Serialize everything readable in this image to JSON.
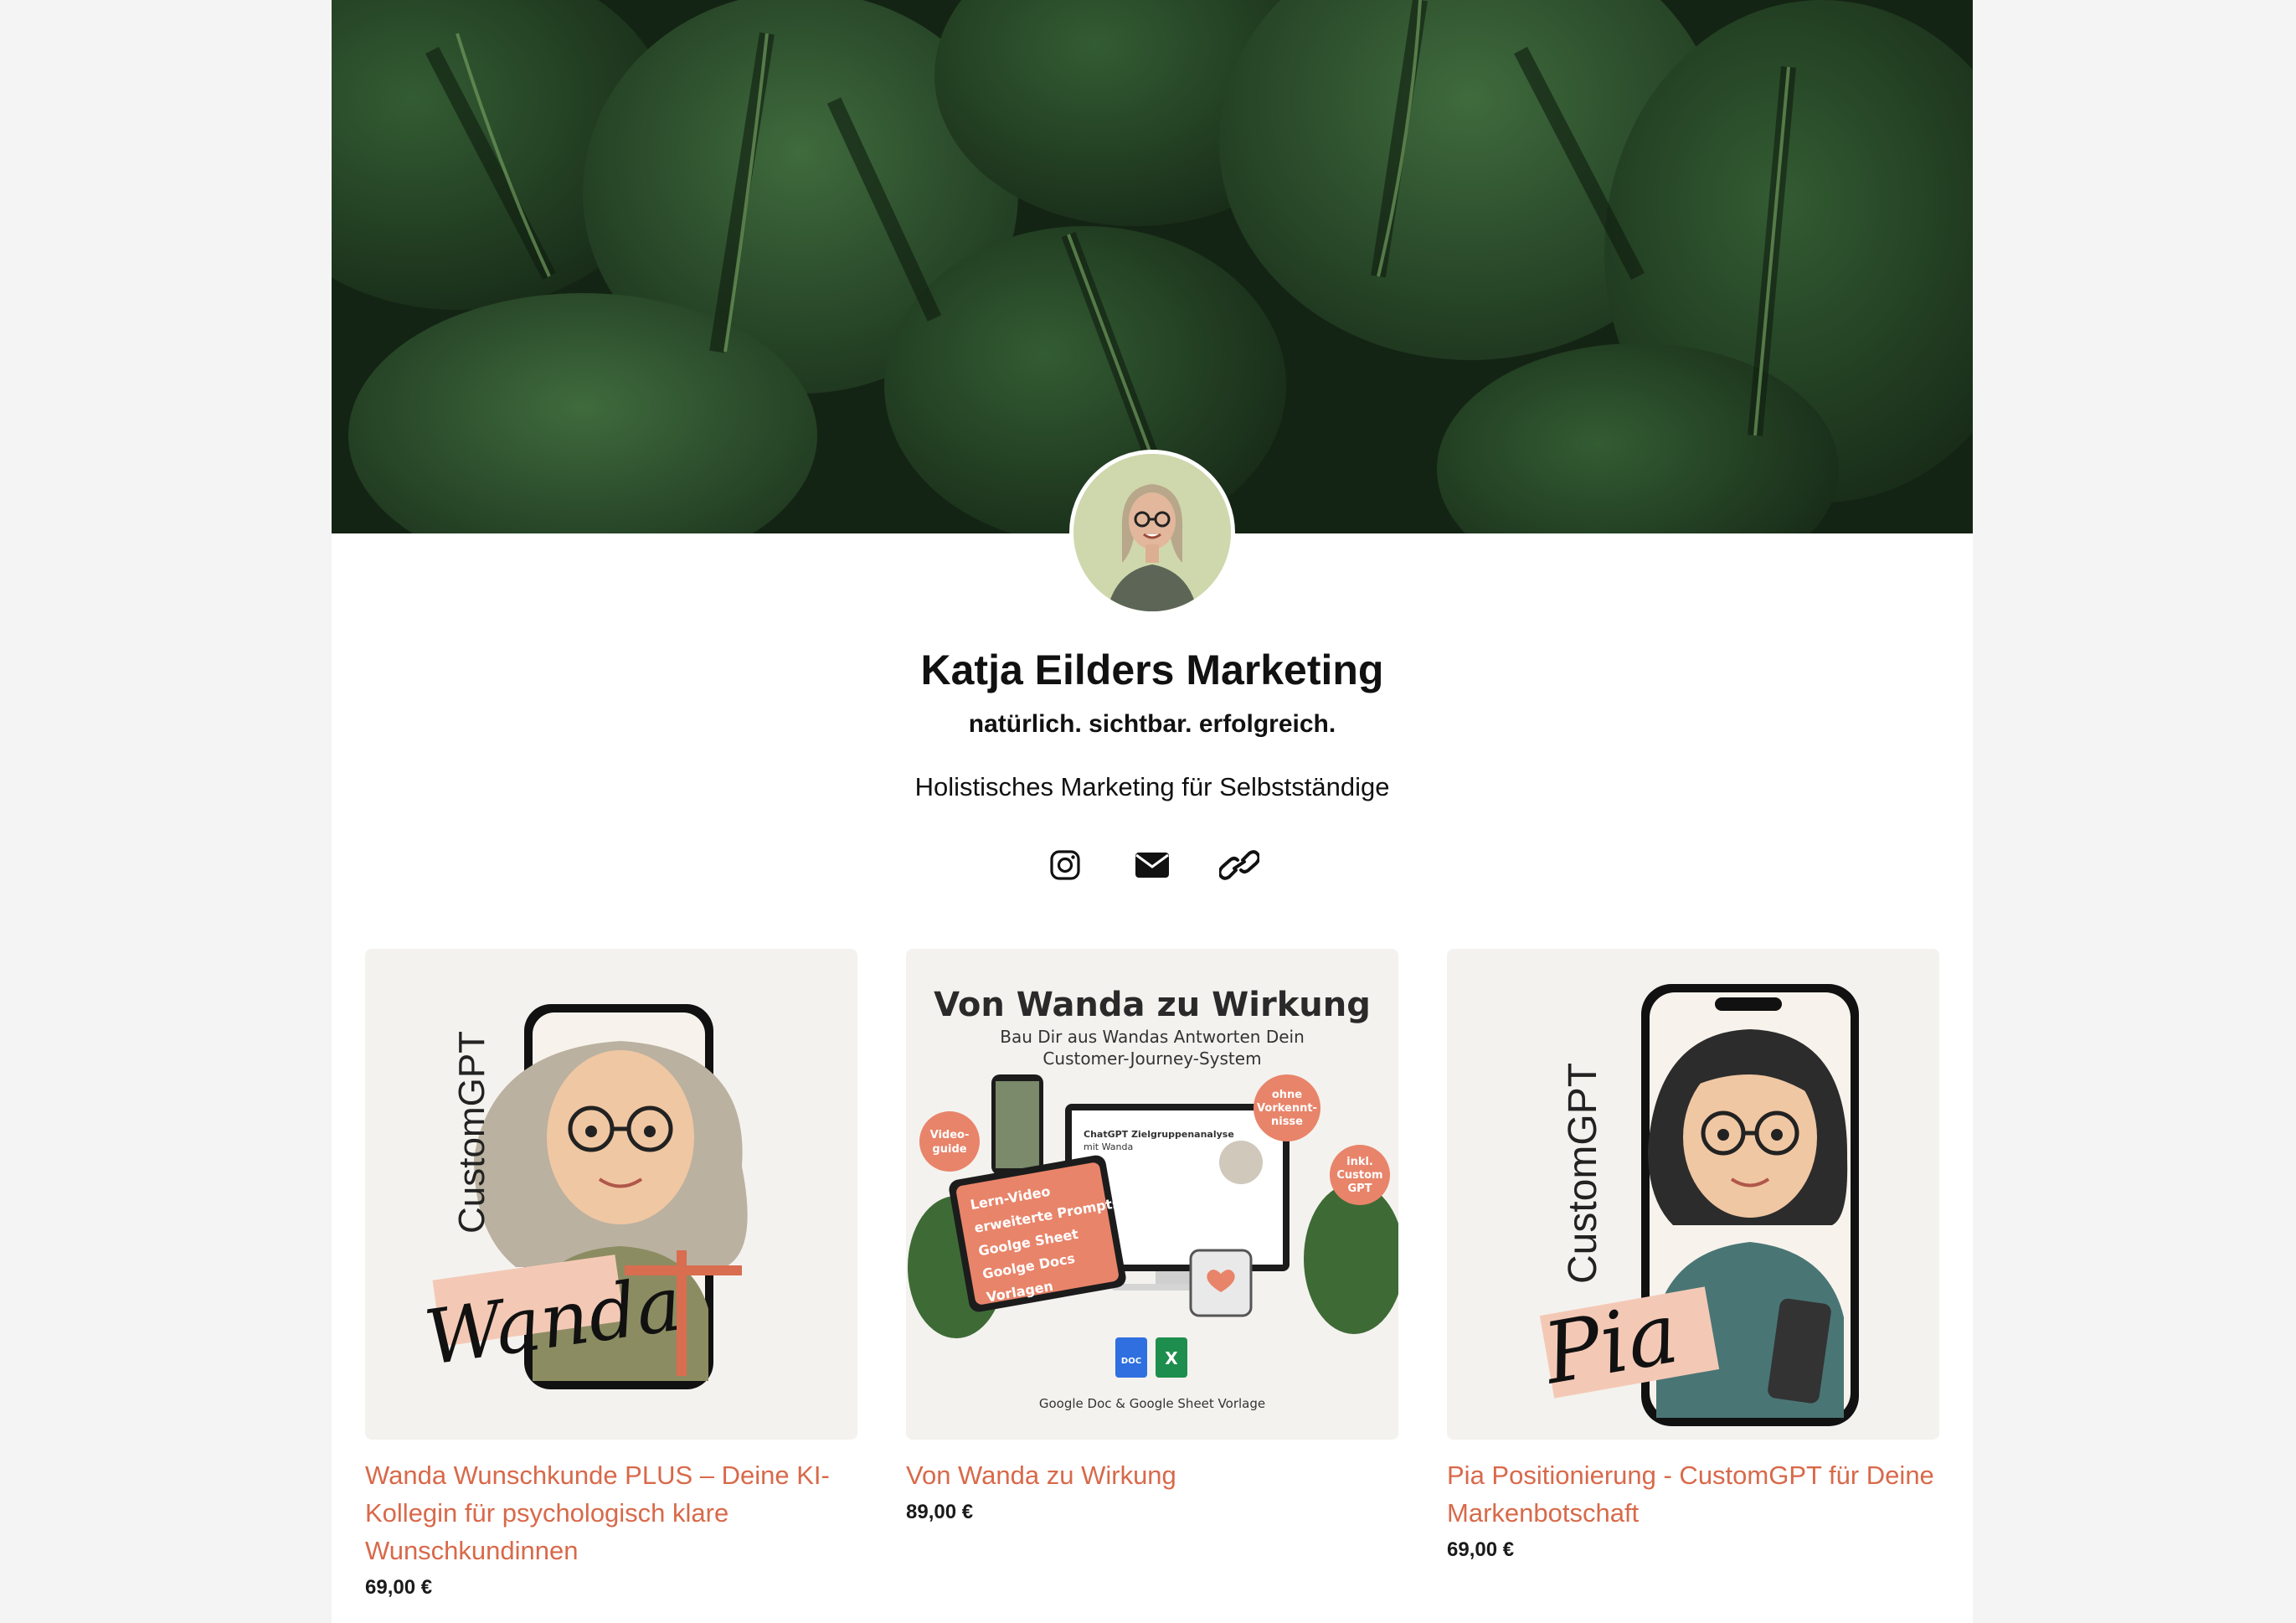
{
  "profile": {
    "name": "Katja Eilders Marketing",
    "tagline": "natürlich. sichtbar. erfolgreich.",
    "description": "Holistisches Marketing für Selbstständige"
  },
  "socials": [
    {
      "icon": "instagram-icon"
    },
    {
      "icon": "mail-icon"
    },
    {
      "icon": "link-icon"
    }
  ],
  "products": [
    {
      "title": "Wanda Wunschkunde PLUS – Deine KI-Kollegin für psychologisch klare Wunschkundinnen",
      "price": "69,00 €",
      "image": {
        "label": "CustomGPT",
        "script": "Wanda"
      }
    },
    {
      "title": "Von Wanda zu Wirkung",
      "price": "89,00 €",
      "image": {
        "heading": "Von Wanda zu Wirkung",
        "sub1": "Bau Dir aus Wandas Antworten Dein",
        "sub2": "Customer-Journey-System",
        "badge_left": [
          "Video-",
          "guide"
        ],
        "badge_top": [
          "ohne",
          "Vorkennt-",
          "nisse"
        ],
        "badge_right": [
          "inkl.",
          "Custom",
          "GPT"
        ],
        "checklist": [
          "Lern-Video",
          "erweiterte Prompts",
          "Goolge Sheet",
          "Goolge Docs",
          "Vorlagen"
        ],
        "screen_title": "ChatGPT Zielgruppenanalyse",
        "screen_sub": "mit Wanda",
        "doc_label": "DOC",
        "footer": "Google Doc &  Google Sheet Vorlage"
      }
    },
    {
      "title": "Pia Positionierung - CustomGPT für Deine Markenbotschaft",
      "price": "69,00 €",
      "image": {
        "label": "CustomGPT",
        "script": "Pia"
      }
    }
  ],
  "colors": {
    "accent": "#d8694a",
    "card_bg": "#f4f2ee",
    "page_bg": "#f4f4f4"
  }
}
